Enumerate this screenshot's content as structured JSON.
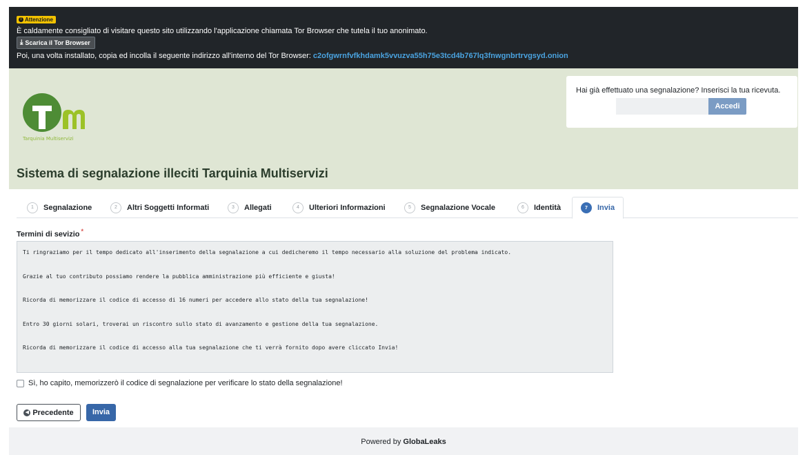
{
  "tor_banner": {
    "badge": "Attenzione",
    "message": "È caldamente consigliato di visitare questo sito utilizzando l'applicazione chiamata Tor Browser che tutela il tuo anonimato.",
    "download_label": "Scarica il Tor Browser",
    "instructions": "Poi, una volta installato, copia ed incolla il seguente indirizzo all'interno del Tor Browser: ",
    "onion_address": "c2ofgwrnfvfkhdamk5vvuzva55h75e3tcd4b767lq3fnwgnbrtrvgsyd.onion"
  },
  "header": {
    "logo_caption": "Tarquinia Multiservizi",
    "site_title": "Sistema di segnalazione illeciti Tarquinia Multiservizi",
    "login": {
      "question": "Hai già effettuato una segnalazione? Inserisci la tua ricevuta.",
      "receipt_placeholder": "",
      "button": "Accedi"
    }
  },
  "tabs": [
    {
      "num": "1",
      "label": "Segnalazione",
      "active": false
    },
    {
      "num": "2",
      "label": "Altri Soggetti Informati",
      "active": false
    },
    {
      "num": "3",
      "label": "Allegati",
      "active": false
    },
    {
      "num": "4",
      "label": "Ulteriori Informazioni",
      "active": false
    },
    {
      "num": "5",
      "label": "Segnalazione Vocale",
      "active": false
    },
    {
      "num": "6",
      "label": "Identità",
      "active": false
    },
    {
      "num": "7",
      "label": "Invia",
      "active": true
    }
  ],
  "terms": {
    "label": "Termini di sevizio",
    "required_mark": "*",
    "paragraphs": [
      "Ti ringraziamo per il tempo dedicato all'inserimento della segnalazione a cui dedicheremo il tempo necessario alla soluzione del problema indicato.",
      "Grazie al tuo contributo possiamo rendere la pubblica amministrazione più efficiente e giusta!",
      "Ricorda di memorizzare il codice di accesso di 16 numeri per accedere allo stato della tua segnalazione!",
      "Entro 30 giorni solari, troverai un riscontro sullo stato di avanzamento e gestione della tua segnalazione.",
      "Ricorda di memorizzare il codice di accesso alla tua segnalazione che ti verrà fornito dopo avere cliccato Invia!"
    ]
  },
  "confirm_checkbox": {
    "label": "Sì, ho capito, memorizzerò il codice di segnalazione per verificare lo stato della segnalazione!",
    "checked": false
  },
  "actions": {
    "previous": "Precedente",
    "submit": "Invia"
  },
  "footer": {
    "prefix": "Powered by ",
    "brand": "GlobaLeaks"
  },
  "colors": {
    "banner_bg": "#212529",
    "header_bg": "#dfe6d4",
    "primary": "#3767a8",
    "logo_green": "#4e8c35",
    "logo_lime": "#9cc227"
  }
}
